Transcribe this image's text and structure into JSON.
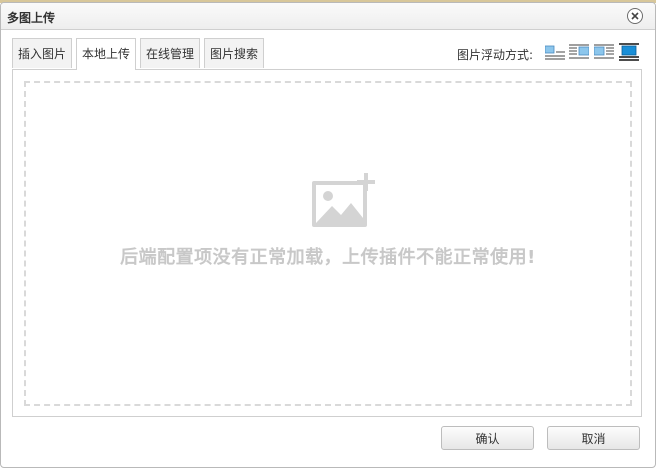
{
  "dialog": {
    "title": "多图上传"
  },
  "tabs": [
    {
      "label": "插入图片",
      "active": false
    },
    {
      "label": "本地上传",
      "active": true
    },
    {
      "label": "在线管理",
      "active": false
    },
    {
      "label": "图片搜索",
      "active": false
    }
  ],
  "float_options": {
    "label": "图片浮动方式:",
    "options": [
      "none",
      "left",
      "right",
      "center"
    ],
    "selected": "center"
  },
  "upload_area": {
    "message": "后端配置项没有正常加载，上传插件不能正常使用!"
  },
  "footer": {
    "confirm_label": "确认",
    "cancel_label": "取消"
  },
  "colors": {
    "accent_blue": "#1a8fd8",
    "dashed_border": "#d9d9d9",
    "message_gray": "#c8c8c8"
  }
}
